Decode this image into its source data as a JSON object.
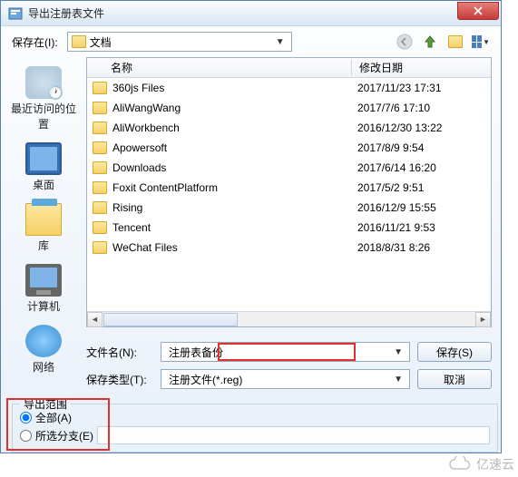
{
  "titlebar": {
    "title": "导出注册表文件"
  },
  "toolbar": {
    "save_in_label": "保存在(I):",
    "location": "文档"
  },
  "sidebar": {
    "items": [
      {
        "label": "最近访问的位置",
        "icon": "recent-places-icon"
      },
      {
        "label": "桌面",
        "icon": "desktop-icon"
      },
      {
        "label": "库",
        "icon": "libraries-icon"
      },
      {
        "label": "计算机",
        "icon": "computer-icon"
      },
      {
        "label": "网络",
        "icon": "network-icon"
      }
    ]
  },
  "filelist": {
    "columns": {
      "name": "名称",
      "date": "修改日期"
    },
    "rows": [
      {
        "name": "360js Files",
        "date": "2017/11/23 17:31"
      },
      {
        "name": "AliWangWang",
        "date": "2017/7/6 17:10"
      },
      {
        "name": "AliWorkbench",
        "date": "2016/12/30 13:22"
      },
      {
        "name": "Apowersoft",
        "date": "2017/8/9 9:54"
      },
      {
        "name": "Downloads",
        "date": "2017/6/14 16:20"
      },
      {
        "name": "Foxit ContentPlatform",
        "date": "2017/5/2 9:51"
      },
      {
        "name": "Rising",
        "date": "2016/12/9 15:55"
      },
      {
        "name": "Tencent",
        "date": "2016/11/21 9:53"
      },
      {
        "name": "WeChat Files",
        "date": "2018/8/31 8:26"
      }
    ]
  },
  "form": {
    "filename_label": "文件名(N):",
    "filename_value": "注册表备份",
    "filetype_label": "保存类型(T):",
    "filetype_value": "注册文件(*.reg)",
    "save_button": "保存(S)",
    "cancel_button": "取消"
  },
  "export_range": {
    "legend": "导出范围",
    "all_label": "全部(A)",
    "branch_label": "所选分支(E)",
    "selected": "all",
    "branch_value": ""
  },
  "watermark": "亿速云"
}
